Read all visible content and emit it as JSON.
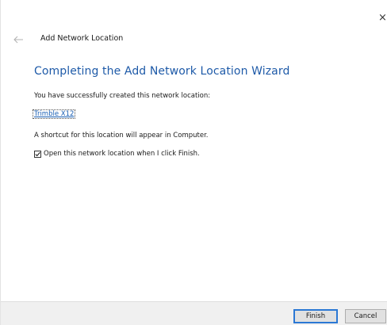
{
  "window": {
    "close_glyph": "×"
  },
  "header": {
    "title": "Add Network Location",
    "back_icon": "back-arrow-icon"
  },
  "main": {
    "heading": "Completing the Add Network Location Wizard",
    "success_text": "You have successfully created this network location:",
    "location_name": "Trimble X12",
    "shortcut_text": "A shortcut for this location will appear in Computer.",
    "checkbox": {
      "label": "Open this network location when I click Finish.",
      "checked": true
    }
  },
  "footer": {
    "finish_label": "Finish",
    "cancel_label": "Cancel"
  },
  "colors": {
    "heading": "#1e5aa8",
    "link": "#1a5fb4",
    "footer_bg": "#f0f0f0",
    "default_button_border": "#2b78d4"
  }
}
